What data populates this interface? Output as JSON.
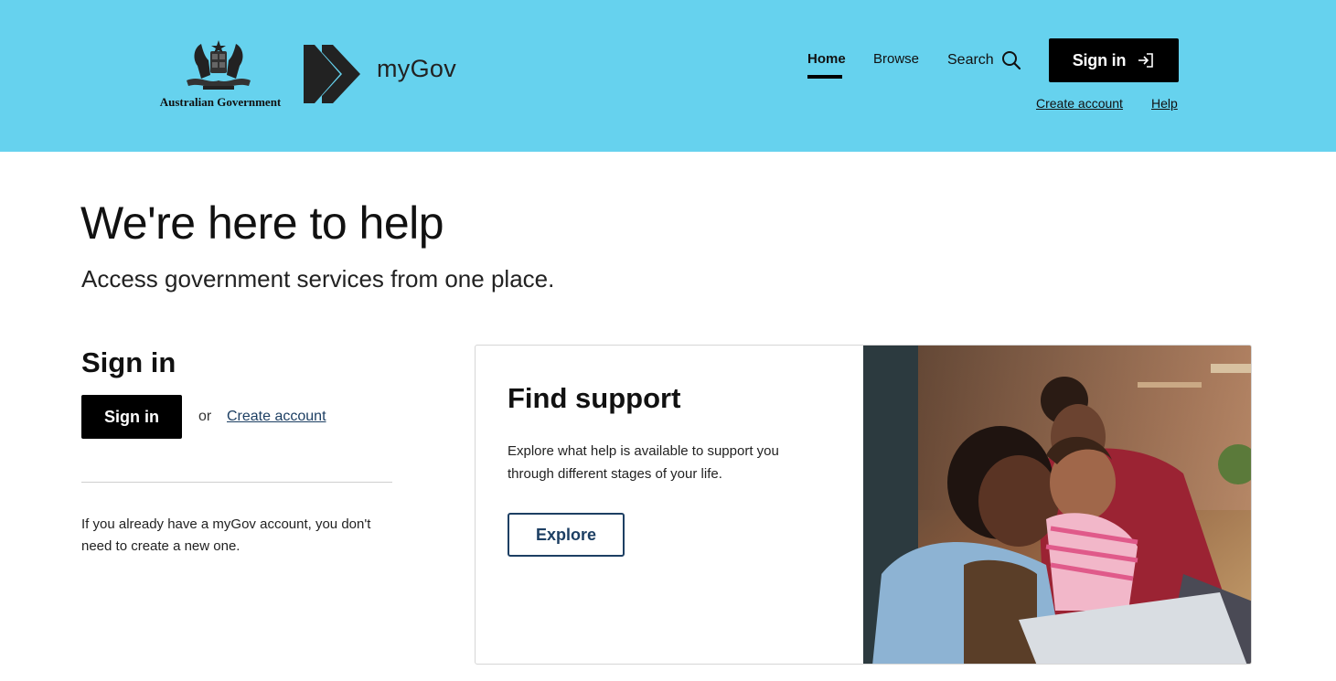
{
  "header": {
    "govt_name": "Australian Government",
    "brand_name": "myGov",
    "background": "#66d2ee",
    "nav": {
      "home": "Home",
      "browse": "Browse",
      "search": "Search"
    },
    "sign_in_label": "Sign in",
    "create_account": "Create account",
    "help": "Help"
  },
  "hero": {
    "title": "We're here to help",
    "subtitle": "Access government services from one place."
  },
  "signin_section": {
    "heading": "Sign in",
    "button_label": "Sign in",
    "or": "or",
    "create_account": "Create account",
    "info": "If you already have a myGov account, you don't need to create a new one."
  },
  "card": {
    "title": "Find support",
    "text": "Explore what help is available to support you through different stages of your life.",
    "button_label": "Explore"
  },
  "icons": {
    "search": "search-icon",
    "sign_in": "sign-in-arrow-icon",
    "crest": "coat-of-arms-icon",
    "brand": "mygov-chevron-logo"
  }
}
